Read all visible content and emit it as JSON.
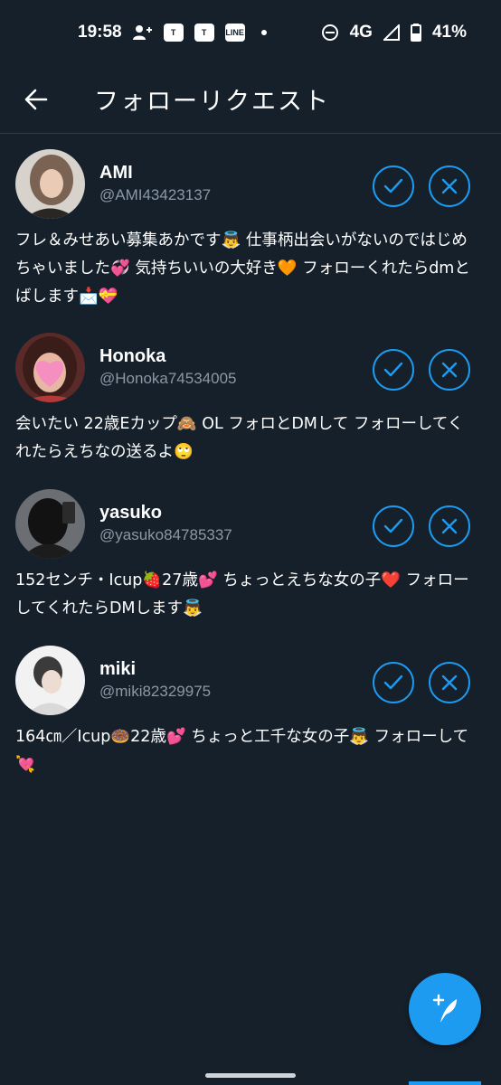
{
  "status_bar": {
    "time": "19:58",
    "network": "4G",
    "battery": "41%",
    "app_badges": [
      "T",
      "T",
      "LINE"
    ]
  },
  "header": {
    "title": "フォローリクエスト"
  },
  "colors": {
    "background": "#15202b",
    "accent": "#1d9bf0",
    "secondary_text": "#8b98a5"
  },
  "requests": [
    {
      "name": "AMI",
      "handle": "@AMI43423137",
      "bio": "フレ＆みせあい募集あかです👼 仕事柄出会いがないのではじめちゃいました💞 気持ちいいの大好き🧡 フォローくれたらdmとばします📩💝"
    },
    {
      "name": "Honoka",
      "handle": "@Honoka74534005",
      "bio": "会いたい 22歳Eカップ🙈 OL フォロとDMして フォローしてくれたらえちなの送るよ🙄"
    },
    {
      "name": "yasuko",
      "handle": "@yasuko84785337",
      "bio": "152センチ・Icup🍓27歳💕 ちょっとえちな女の子❤️ フォローしてくれたらDMします👼"
    },
    {
      "name": "miki",
      "handle": "@miki82329975",
      "bio": "164㎝／Icup🍩22歳💕 ちょっと工千な女の子👼 フォローして💘"
    }
  ]
}
